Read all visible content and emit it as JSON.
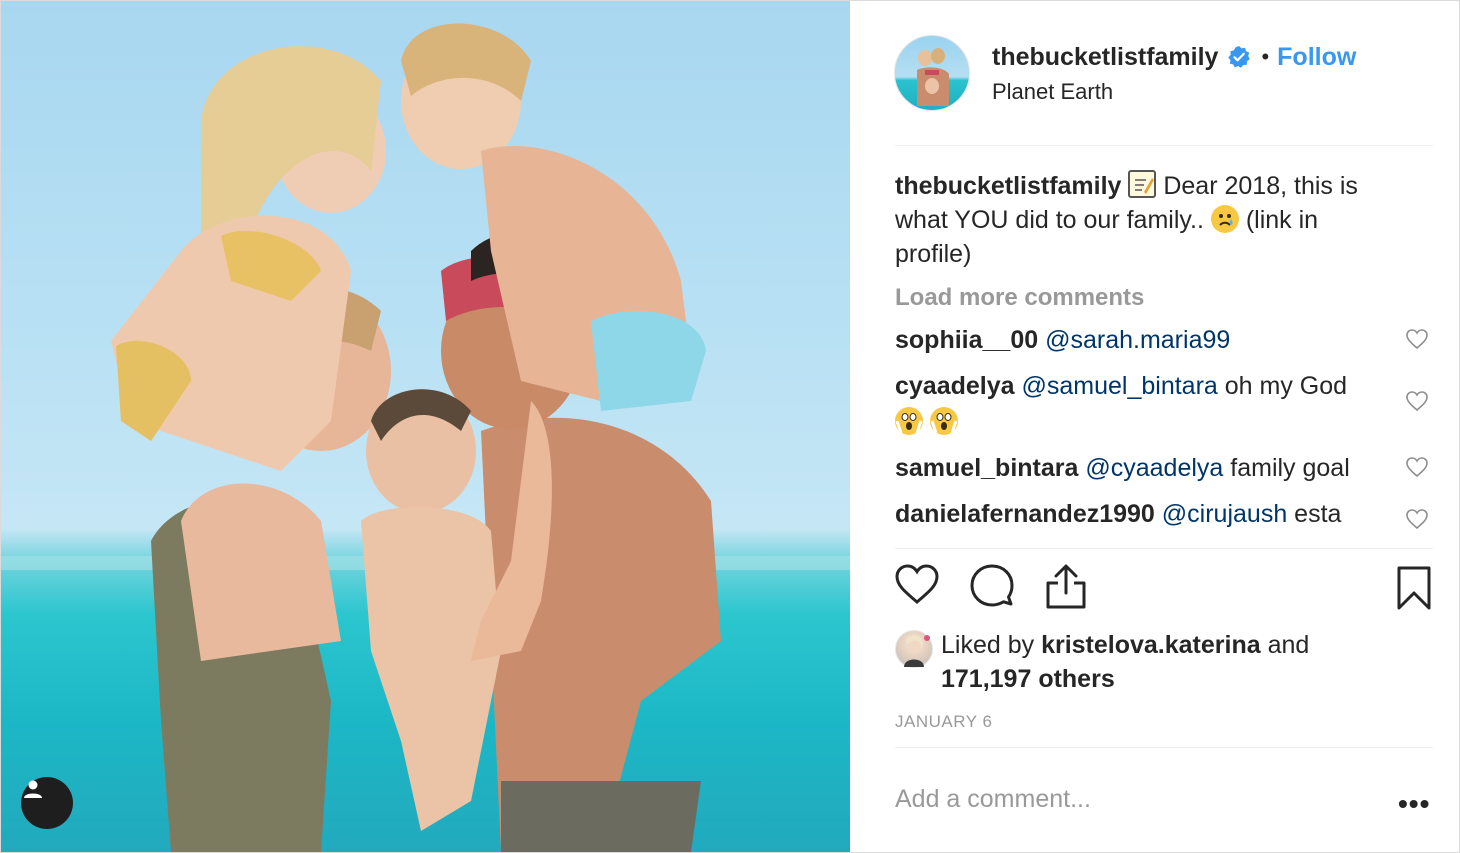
{
  "post": {
    "photo_alt": "",
    "tag_button_icon": "user-icon"
  },
  "header": {
    "username": "thebucketlistfamily",
    "verified_icon": "verified-badge-icon",
    "separator": "•",
    "follow_label": "Follow",
    "location": "Planet Earth"
  },
  "caption": {
    "username": "thebucketlistfamily",
    "text_1": " Dear 2018, this is what YOU did to our family.. ",
    "text_2": " (link in profile)"
  },
  "load_more_label": "Load more comments",
  "comments": [
    {
      "username": "sophiia__00",
      "mention": "@sarah.maria99",
      "text": ""
    },
    {
      "username": "cyaadelya",
      "mention": "@samuel_bintara",
      "text": " oh my God"
    },
    {
      "username": "samuel_bintara",
      "mention": "@cyaadelya",
      "text": " family goal"
    },
    {
      "username": "danielafernandez1990",
      "mention": "@cirujaush",
      "text": " esta"
    }
  ],
  "likes": {
    "prefix": "Liked by ",
    "liker": "kristelova.katerina",
    "middle": " and",
    "others": "171,197 others"
  },
  "date": "JANUARY 6",
  "add_comment_placeholder": "Add a comment...",
  "more_label": "•••",
  "colors": {
    "link_blue": "#3897f0",
    "mention_blue": "#003569",
    "muted": "#999999",
    "text": "#262626",
    "divider": "#efefef"
  }
}
